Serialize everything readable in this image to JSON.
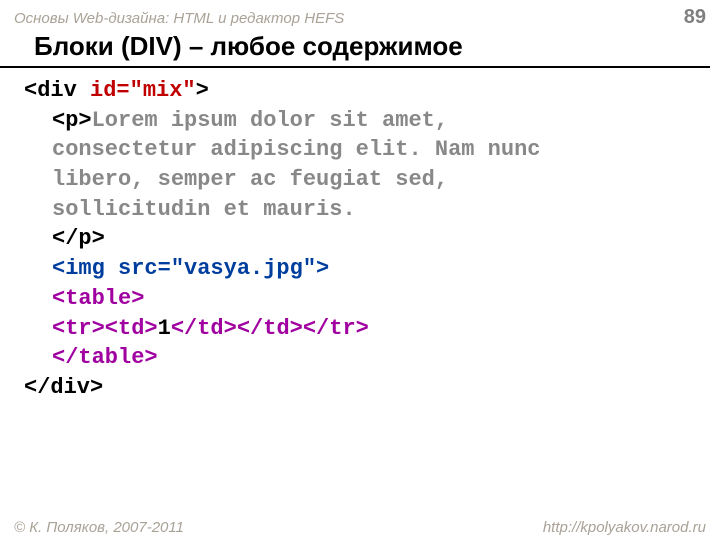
{
  "header": {
    "course": "Основы Web-дизайна: HTML и редактор HEFS",
    "page": "89"
  },
  "title": "Блоки (DIV) – любое содержимое",
  "code": {
    "l1a": "<div ",
    "l1b": "id=\"mix\"",
    "l1c": ">",
    "l2a": "<p>",
    "l2b": "Lorem ipsum dolor sit amet,",
    "l3": "consectetur adipiscing elit. Nam nunc",
    "l4": "libero, semper ac feugiat sed,",
    "l5": "sollicitudin et mauris.",
    "l6": "</p>",
    "l7": "<img src=\"vasya.jpg\">",
    "l8": "<table>",
    "l9a": "<tr><td>",
    "l9b": "1",
    "l9c": "</td></td></tr>",
    "l10": "</table>",
    "l11": "</div>"
  },
  "footer": {
    "copyright": "© К. Поляков, 2007-2011",
    "url": "http://kpolyakov.narod.ru"
  }
}
